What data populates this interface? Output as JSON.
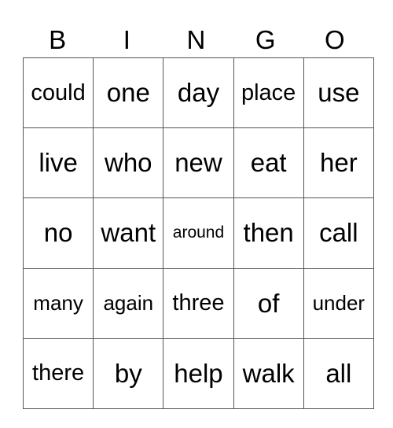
{
  "title_letters": [
    "B",
    "I",
    "N",
    "G",
    "O"
  ],
  "rows": [
    [
      "could",
      "one",
      "day",
      "place",
      "use"
    ],
    [
      "live",
      "who",
      "new",
      "eat",
      "her"
    ],
    [
      "no",
      "want",
      "around",
      "then",
      "call"
    ],
    [
      "many",
      "again",
      "three",
      "of",
      "under"
    ],
    [
      "there",
      "by",
      "help",
      "walk",
      "all"
    ]
  ]
}
